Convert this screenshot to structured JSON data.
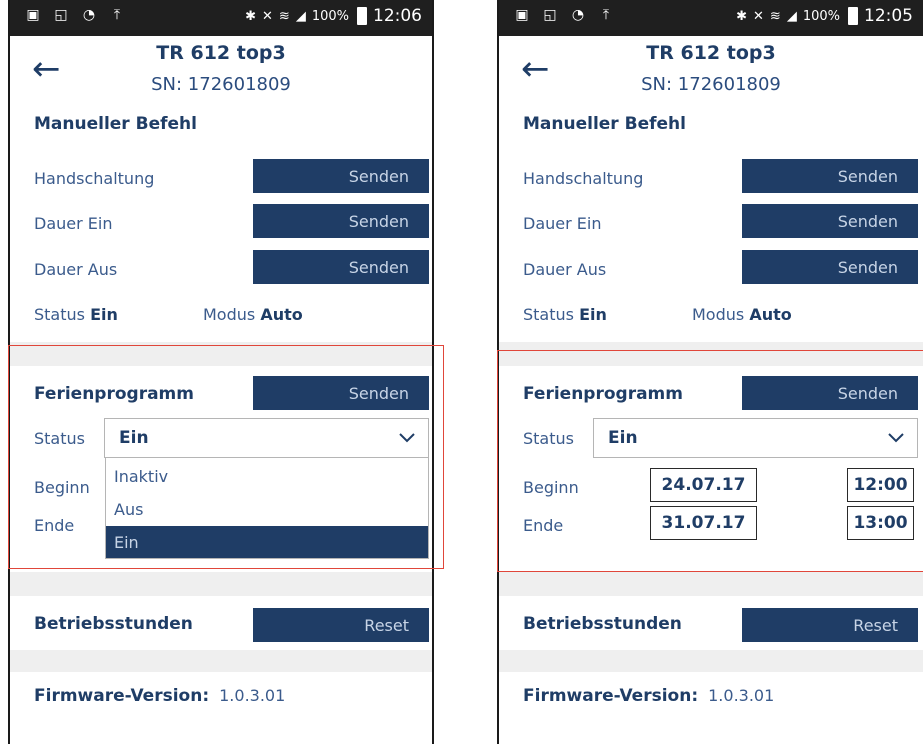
{
  "left": {
    "status_bar": {
      "battery": "100%",
      "time": "12:06"
    },
    "header": {
      "title": "TR 612 top3",
      "serial": "SN: 172601809"
    },
    "manual": {
      "title": "Manueller Befehl",
      "rows": [
        {
          "label": "Handschaltung",
          "button": "Senden"
        },
        {
          "label": "Dauer Ein",
          "button": "Senden"
        },
        {
          "label": "Dauer Aus",
          "button": "Senden"
        }
      ],
      "status_label": "Status",
      "status_value": "Ein",
      "mode_label": "Modus",
      "mode_value": "Auto"
    },
    "holiday": {
      "title": "Ferienprogramm",
      "button": "Senden",
      "status_label": "Status",
      "status_value": "Ein",
      "begin_label": "Beginn",
      "end_label": "Ende",
      "options": [
        "Inaktiv",
        "Aus",
        "Ein"
      ],
      "selected_option": "Ein"
    },
    "hours": {
      "title": "Betriebsstunden",
      "button": "Reset"
    },
    "firmware": {
      "label": "Firmware-Version:",
      "value": "1.0.3.01"
    }
  },
  "right": {
    "status_bar": {
      "battery": "100%",
      "time": "12:05"
    },
    "header": {
      "title": "TR 612 top3",
      "serial": "SN: 172601809"
    },
    "manual": {
      "title": "Manueller Befehl",
      "rows": [
        {
          "label": "Handschaltung",
          "button": "Senden"
        },
        {
          "label": "Dauer Ein",
          "button": "Senden"
        },
        {
          "label": "Dauer Aus",
          "button": "Senden"
        }
      ],
      "status_label": "Status",
      "status_value": "Ein",
      "mode_label": "Modus",
      "mode_value": "Auto"
    },
    "holiday": {
      "title": "Ferienprogramm",
      "button": "Senden",
      "status_label": "Status",
      "status_value": "Ein",
      "begin_label": "Beginn",
      "begin_date": "24.07.17",
      "begin_time": "12:00",
      "end_label": "Ende",
      "end_date": "31.07.17",
      "end_time": "13:00"
    },
    "hours": {
      "title": "Betriebsstunden",
      "button": "Reset"
    },
    "firmware": {
      "label": "Firmware-Version:",
      "value": "1.0.3.01"
    }
  },
  "colors": {
    "primary": "#1f3d66",
    "highlight_frame": "#e0463a",
    "status_bar": "#1f1f1f",
    "band": "#efefef"
  }
}
